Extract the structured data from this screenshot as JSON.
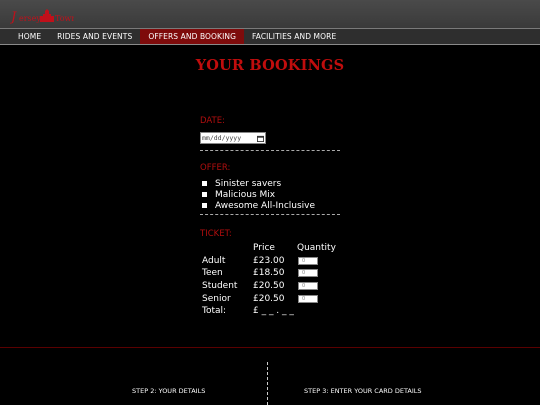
{
  "header": {
    "logo_text": "Jersey Town"
  },
  "nav": {
    "items": [
      {
        "label": "HOME"
      },
      {
        "label": "RIDES AND EVENTS"
      },
      {
        "label": "OFFERS AND BOOKING"
      },
      {
        "label": "FACILITIES AND MORE"
      }
    ],
    "active_index": 2
  },
  "page": {
    "title": "YOUR BOOKINGS"
  },
  "date": {
    "label": "DATE:",
    "placeholder": "mm/dd/yyyy",
    "icon": "calendar-icon"
  },
  "offer": {
    "label": "OFFER:",
    "options": [
      {
        "label": "Sinister savers"
      },
      {
        "label": "Malicious Mix"
      },
      {
        "label": "Awesome All-Inclusive"
      }
    ]
  },
  "ticket": {
    "label": "TICKET:",
    "headers": {
      "price": "Price",
      "quantity": "Quantity"
    },
    "rows": [
      {
        "type": "Adult",
        "price": "£23.00",
        "qty": "0"
      },
      {
        "type": "Teen",
        "price": "£18.50",
        "qty": "0"
      },
      {
        "type": "Student",
        "price": "£20.50",
        "qty": "0"
      },
      {
        "type": "Senior",
        "price": "£20.50",
        "qty": "0"
      }
    ],
    "total_label": "Total:",
    "total_value": "£ _ _ . _ _"
  },
  "steps": {
    "step2": "STEP 2: YOUR DETAILS",
    "step3": "STEP 3: ENTER YOUR CARD DETAILS"
  },
  "colors": {
    "accent": "#c00d0d",
    "nav_active": "#7e0b0b",
    "background": "#000000"
  }
}
